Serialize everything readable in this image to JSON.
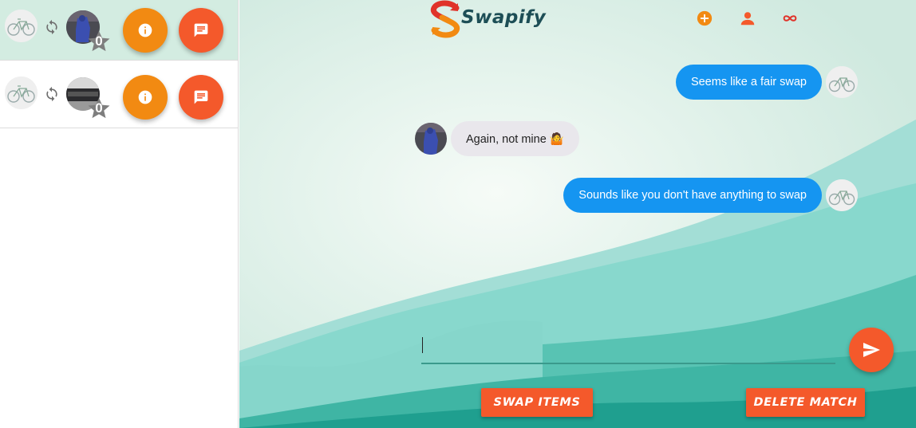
{
  "app": {
    "name": "Swapify"
  },
  "colors": {
    "accent": "#f4592b",
    "info": "#f28a12",
    "bubble_mine": "#1595f1",
    "bubble_theirs": "#e9e7ec",
    "active_row": "#d3ece1"
  },
  "sidebar": {
    "matches": [
      {
        "my_item_icon": "bicycle-icon",
        "swap_icon": "sync-icon",
        "partner_image": "partner-photo",
        "rating": "0",
        "info_icon": "info-icon",
        "chat_icon": "chat-icon",
        "active": true
      },
      {
        "my_item_icon": "bicycle-icon",
        "swap_icon": "sync-icon",
        "partner_image": "car-photo",
        "rating": "0",
        "info_icon": "info-icon",
        "chat_icon": "chat-icon",
        "active": false
      }
    ]
  },
  "nav": {
    "icons": [
      "add-circle-icon",
      "person-icon",
      "infinity-icon"
    ]
  },
  "messages": [
    {
      "text": "Seems like a fair swap",
      "from": "me"
    },
    {
      "text": "Again, not mine 🤷",
      "from": "them"
    },
    {
      "text": "Sounds like you don't have anything to swap",
      "from": "me"
    }
  ],
  "composer": {
    "value": "",
    "placeholder": "",
    "send_icon": "send-icon"
  },
  "actions": {
    "swap_label": "Swap items",
    "delete_label": "Delete match"
  }
}
